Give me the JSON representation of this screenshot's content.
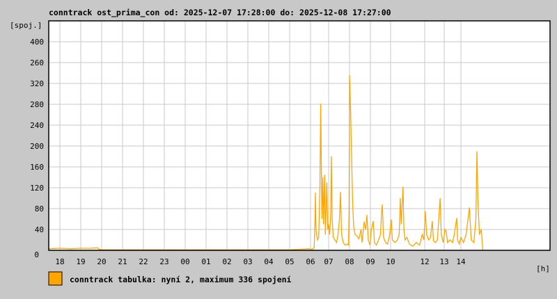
{
  "chart_data": {
    "type": "line",
    "title": "conntrack ost_prima_con od: 2025-12-07 17:28:00 do: 2025-12-08 17:27:00",
    "ylabel": "[spoj.]",
    "xlabel": "[h]",
    "ylim": [
      0,
      440
    ],
    "xlim_hours": [
      17.47,
      41.45
    ],
    "y_ticks": [
      {
        "value": 400,
        "label": "400"
      },
      {
        "value": 360,
        "label": "260"
      },
      {
        "value": 320,
        "label": "320"
      },
      {
        "value": 280,
        "label": "280"
      },
      {
        "value": 240,
        "label": "240"
      },
      {
        "value": 200,
        "label": "200"
      },
      {
        "value": 160,
        "label": "160"
      },
      {
        "value": 120,
        "label": "120"
      },
      {
        "value": 80,
        "label": "80"
      },
      {
        "value": 40,
        "label": "40"
      },
      {
        "value": 0,
        "label": "0"
      }
    ],
    "x_ticks": [
      {
        "hour": 18,
        "label": "18"
      },
      {
        "hour": 19,
        "label": "19"
      },
      {
        "hour": 20,
        "label": "20"
      },
      {
        "hour": 21,
        "label": "21"
      },
      {
        "hour": 22,
        "label": "22"
      },
      {
        "hour": 23,
        "label": "23"
      },
      {
        "hour": 24,
        "label": "00"
      },
      {
        "hour": 25,
        "label": "01"
      },
      {
        "hour": 26,
        "label": "02"
      },
      {
        "hour": 27,
        "label": "03"
      },
      {
        "hour": 28,
        "label": "04"
      },
      {
        "hour": 29,
        "label": "05"
      },
      {
        "hour": 30,
        "label": "06"
      },
      {
        "hour": 31,
        "label": "07"
      },
      {
        "hour": 32,
        "label": "08"
      },
      {
        "hour": 33,
        "label": "09"
      },
      {
        "hour": 34,
        "label": "10"
      },
      {
        "hour": 36,
        "label": "12"
      },
      {
        "hour": 37,
        "label": "13"
      },
      {
        "hour": 38,
        "label": "14"
      }
    ],
    "series": [
      {
        "name": "conntrack tabulka",
        "color": "#ffa500",
        "points": [
          [
            17.47,
            3
          ],
          [
            18.0,
            4
          ],
          [
            18.5,
            3
          ],
          [
            19.0,
            4
          ],
          [
            19.5,
            4
          ],
          [
            19.8,
            5
          ],
          [
            19.9,
            2
          ],
          [
            20.0,
            1
          ],
          [
            21,
            1
          ],
          [
            22,
            1
          ],
          [
            23,
            1
          ],
          [
            24,
            1
          ],
          [
            25,
            1
          ],
          [
            26,
            1
          ],
          [
            27,
            1
          ],
          [
            28,
            1
          ],
          [
            29,
            1
          ],
          [
            29.5,
            2
          ],
          [
            29.9,
            3
          ],
          [
            30.1,
            2
          ],
          [
            30.2,
            5
          ],
          [
            30.25,
            60
          ],
          [
            30.27,
            111
          ],
          [
            30.3,
            40
          ],
          [
            30.38,
            20
          ],
          [
            30.45,
            25
          ],
          [
            30.52,
            120
          ],
          [
            30.56,
            281
          ],
          [
            30.6,
            150
          ],
          [
            30.63,
            60
          ],
          [
            30.68,
            140
          ],
          [
            30.72,
            50
          ],
          [
            30.78,
            145
          ],
          [
            30.82,
            30
          ],
          [
            30.9,
            130
          ],
          [
            30.95,
            40
          ],
          [
            31.0,
            50
          ],
          [
            31.05,
            30
          ],
          [
            31.1,
            70
          ],
          [
            31.13,
            180
          ],
          [
            31.17,
            60
          ],
          [
            31.22,
            25
          ],
          [
            31.3,
            20
          ],
          [
            31.38,
            15
          ],
          [
            31.45,
            30
          ],
          [
            31.52,
            60
          ],
          [
            31.57,
            112
          ],
          [
            31.62,
            30
          ],
          [
            31.7,
            15
          ],
          [
            31.8,
            10
          ],
          [
            31.9,
            12
          ],
          [
            31.95,
            10
          ],
          [
            31.98,
            80
          ],
          [
            32.0,
            336
          ],
          [
            32.05,
            270
          ],
          [
            32.1,
            180
          ],
          [
            32.15,
            90
          ],
          [
            32.2,
            45
          ],
          [
            32.27,
            30
          ],
          [
            32.35,
            28
          ],
          [
            32.45,
            22
          ],
          [
            32.55,
            40
          ],
          [
            32.6,
            15
          ],
          [
            32.7,
            55
          ],
          [
            32.78,
            40
          ],
          [
            32.83,
            68
          ],
          [
            32.9,
            20
          ],
          [
            32.98,
            10
          ],
          [
            33.05,
            40
          ],
          [
            33.14,
            56
          ],
          [
            33.2,
            15
          ],
          [
            33.3,
            10
          ],
          [
            33.4,
            20
          ],
          [
            33.5,
            30
          ],
          [
            33.55,
            70
          ],
          [
            33.59,
            88
          ],
          [
            33.65,
            25
          ],
          [
            33.75,
            15
          ],
          [
            33.85,
            12
          ],
          [
            33.95,
            30
          ],
          [
            34.04,
            59
          ],
          [
            34.1,
            20
          ],
          [
            34.25,
            15
          ],
          [
            34.4,
            20
          ],
          [
            34.5,
            30
          ],
          [
            34.57,
            100
          ],
          [
            34.62,
            50
          ],
          [
            34.73,
            122
          ],
          [
            34.78,
            40
          ],
          [
            34.85,
            20
          ],
          [
            34.95,
            25
          ],
          [
            35.1,
            12
          ],
          [
            35.3,
            8
          ],
          [
            35.5,
            15
          ],
          [
            35.7,
            10
          ],
          [
            35.85,
            30
          ],
          [
            35.95,
            20
          ],
          [
            36.03,
            75
          ],
          [
            36.1,
            30
          ],
          [
            36.2,
            20
          ],
          [
            36.3,
            25
          ],
          [
            36.39,
            56
          ],
          [
            36.45,
            18
          ],
          [
            36.55,
            15
          ],
          [
            36.65,
            20
          ],
          [
            36.72,
            60
          ],
          [
            36.79,
            100
          ],
          [
            36.85,
            30
          ],
          [
            36.95,
            15
          ],
          [
            37.05,
            40
          ],
          [
            37.12,
            36
          ],
          [
            37.2,
            15
          ],
          [
            37.35,
            20
          ],
          [
            37.5,
            15
          ],
          [
            37.6,
            30
          ],
          [
            37.75,
            62
          ],
          [
            37.8,
            20
          ],
          [
            37.9,
            12
          ],
          [
            38.0,
            25
          ],
          [
            38.1,
            15
          ],
          [
            38.2,
            30
          ],
          [
            38.33,
            82
          ],
          [
            38.4,
            20
          ],
          [
            38.5,
            15
          ],
          [
            38.58,
            60
          ],
          [
            38.62,
            190
          ],
          [
            38.66,
            90
          ],
          [
            38.72,
            30
          ],
          [
            38.79,
            40
          ],
          [
            38.83,
            10
          ],
          [
            38.85,
            0
          ]
        ]
      }
    ],
    "legend": {
      "text": "conntrack tabulka: nyní 2, maximum 336 spojení",
      "color": "#ffa500",
      "placement": "bottom-left"
    }
  }
}
